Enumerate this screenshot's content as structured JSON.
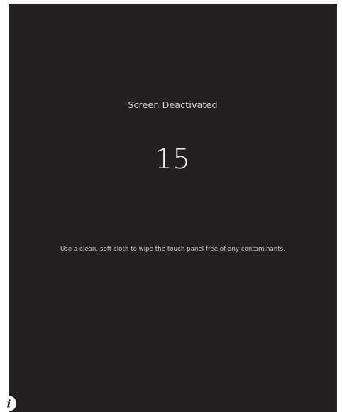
{
  "screen": {
    "title": "Screen Deactivated",
    "countdown": "15",
    "instruction": "Use a clean, soft cloth to wipe the touch panel free of any contaminants."
  },
  "info": {
    "icon": "info-icon",
    "label": "i"
  },
  "colors": {
    "background": "#242022",
    "text": "#d9d6d7",
    "countdown": "#f2f2f2",
    "info_icon": "#ffffff"
  }
}
